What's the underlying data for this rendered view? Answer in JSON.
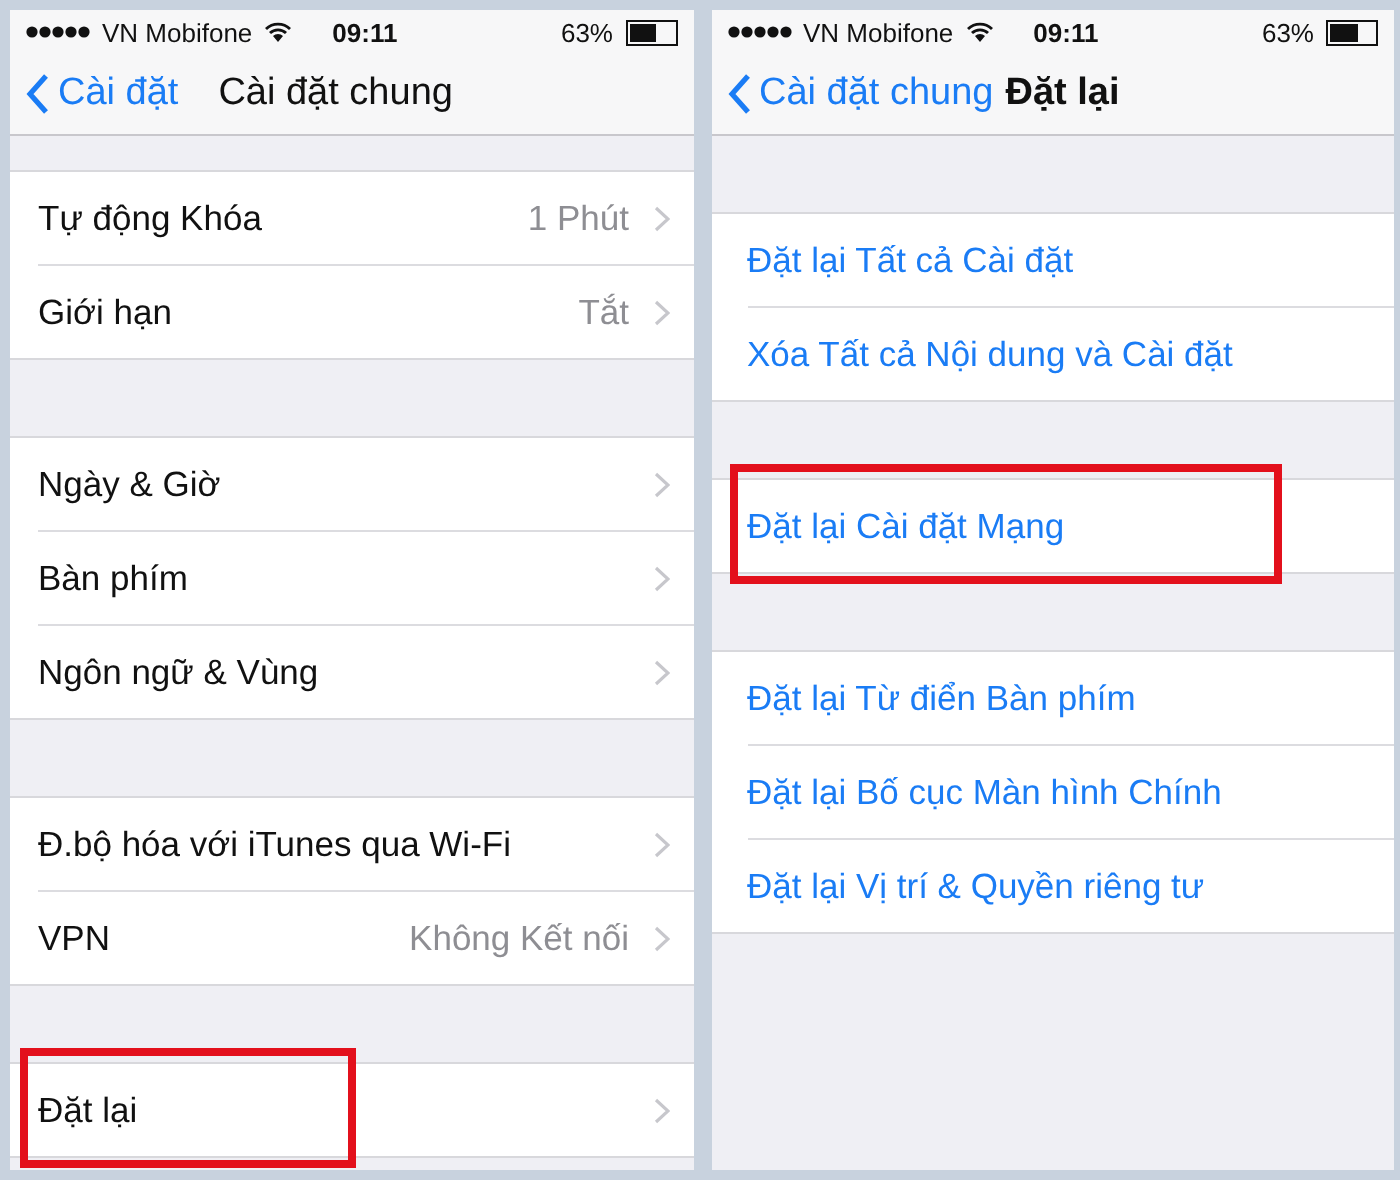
{
  "screens": [
    {
      "status_bar": {
        "carrier": "VN Mobifone",
        "time": "09:11",
        "battery": "63%"
      },
      "nav": {
        "back": "Cài đặt",
        "title": "Cài đặt chung"
      },
      "groups": [
        [
          {
            "kind": "link",
            "label": "Tự động Khóa",
            "value": "1 Phút",
            "highlighted": false
          },
          {
            "kind": "link",
            "label": "Giới hạn",
            "value": "Tắt",
            "highlighted": false
          }
        ],
        [
          {
            "kind": "link",
            "label": "Ngày & Giờ",
            "highlighted": false
          },
          {
            "kind": "link",
            "label": "Bàn phím",
            "highlighted": false
          },
          {
            "kind": "link",
            "label": "Ngôn ngữ & Vùng",
            "highlighted": false
          }
        ],
        [
          {
            "kind": "link",
            "label": "Đ.bộ hóa với iTunes qua Wi-Fi",
            "highlighted": false
          },
          {
            "kind": "link",
            "label": "VPN",
            "value": "Không Kết nối",
            "highlighted": false
          }
        ],
        [
          {
            "kind": "link",
            "label": "Đặt lại",
            "highlighted": true
          }
        ]
      ]
    },
    {
      "status_bar": {
        "carrier": "VN Mobifone",
        "time": "09:11",
        "battery": "63%"
      },
      "nav": {
        "back": "Cài đặt chung",
        "title": "Đặt lại"
      },
      "groups": [
        [
          {
            "kind": "action",
            "label": "Đặt lại Tất cả Cài đặt",
            "highlighted": false
          },
          {
            "kind": "action",
            "label": "Xóa Tất cả Nội dung và Cài đặt",
            "highlighted": false
          }
        ],
        [
          {
            "kind": "action",
            "label": "Đặt lại Cài đặt Mạng",
            "highlighted": true
          }
        ],
        [
          {
            "kind": "action",
            "label": "Đặt lại Từ điển Bàn phím",
            "highlighted": false
          },
          {
            "kind": "action",
            "label": "Đặt lại Bố cục Màn hình Chính",
            "highlighted": false
          },
          {
            "kind": "action",
            "label": "Đặt lại Vị trí & Quyền riêng tư",
            "highlighted": false
          }
        ]
      ]
    }
  ]
}
